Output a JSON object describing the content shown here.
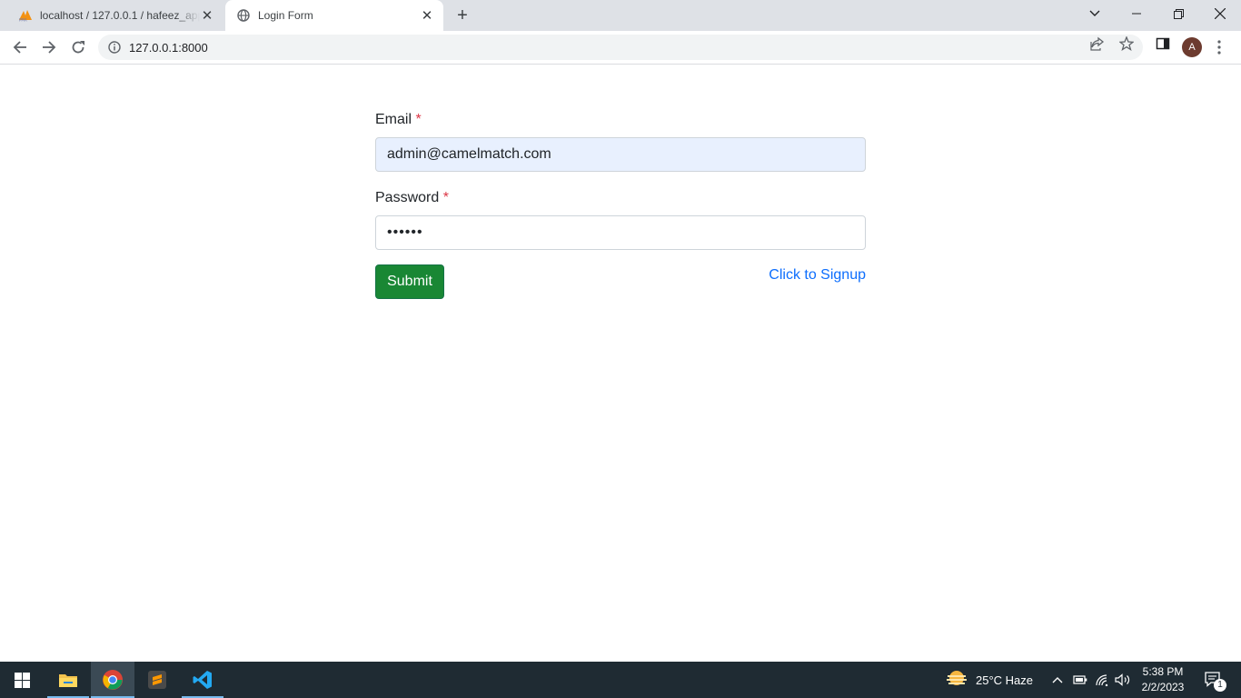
{
  "browser": {
    "tabs": [
      {
        "title": "localhost / 127.0.0.1 / hafeez_app",
        "active": false
      },
      {
        "title": "Login Form",
        "active": true
      }
    ],
    "url": "127.0.0.1:8000",
    "profile_initial": "A"
  },
  "form": {
    "email_label": "Email",
    "email_value": "admin@camelmatch.com",
    "password_label": "Password",
    "password_value": "••••••",
    "required_marker": "*",
    "submit_label": "Submit",
    "signup_link": "Click to Signup"
  },
  "taskbar": {
    "weather": "25°C  Haze",
    "time": "5:38 PM",
    "date": "2/2/2023",
    "notification_count": "1"
  },
  "colors": {
    "submit_bg": "#198734",
    "link": "#0d6efd",
    "required": "#dc3545",
    "autofill_bg": "#e8f0fe",
    "taskbar_bg": "#1f2b33"
  }
}
